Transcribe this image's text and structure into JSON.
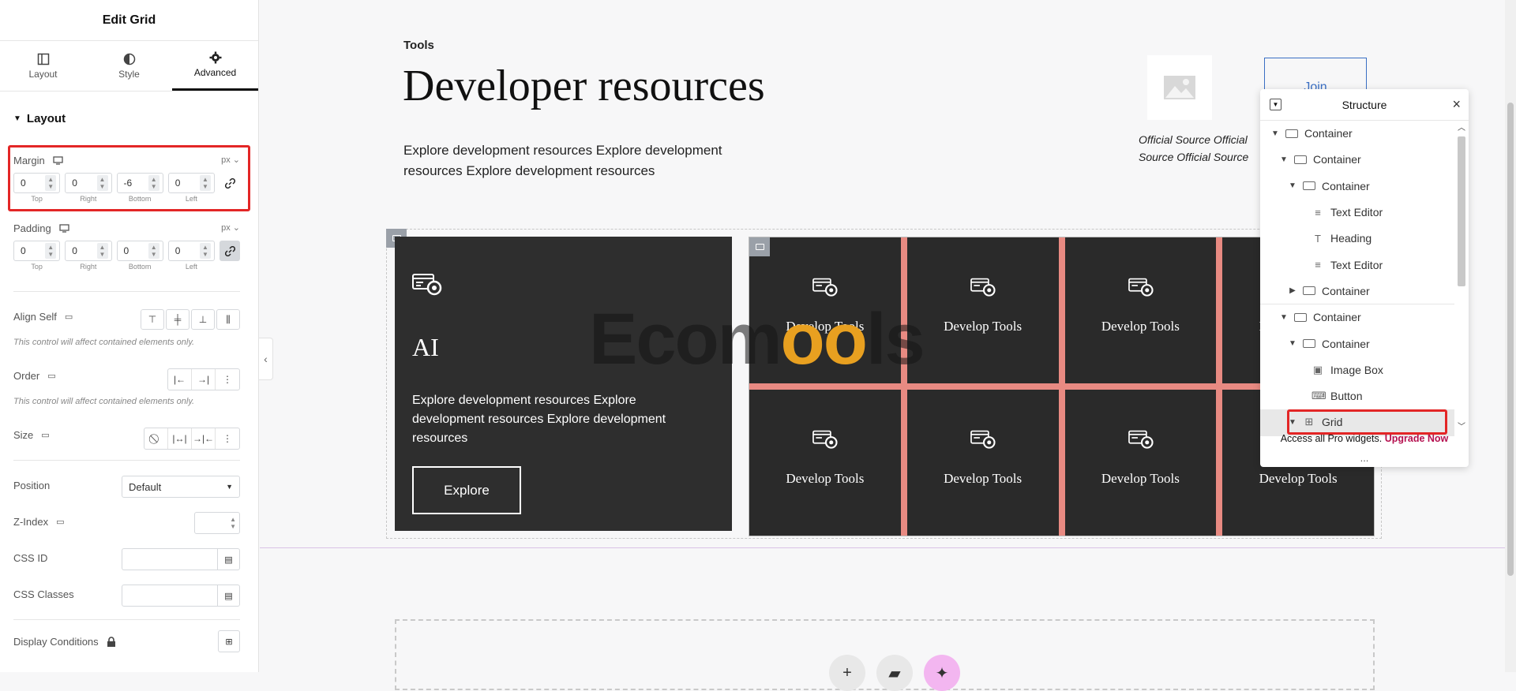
{
  "panel": {
    "title": "Edit Grid",
    "tabs": [
      {
        "label": "Layout"
      },
      {
        "label": "Style"
      },
      {
        "label": "Advanced"
      }
    ],
    "section": "Layout",
    "margin": {
      "label": "Margin",
      "unit": "px",
      "top": "0",
      "right": "0",
      "bottom": "-6",
      "left": "0"
    },
    "padding": {
      "label": "Padding",
      "unit": "px",
      "top": "0",
      "right": "0",
      "bottom": "0",
      "left": "0"
    },
    "sides": [
      "Top",
      "Right",
      "Bottom",
      "Left"
    ],
    "align_self": {
      "label": "Align Self",
      "note": "This control will affect contained elements only."
    },
    "order": {
      "label": "Order",
      "note": "This control will affect contained elements only."
    },
    "size": {
      "label": "Size"
    },
    "position": {
      "label": "Position",
      "value": "Default"
    },
    "zindex": {
      "label": "Z-Index"
    },
    "css_id": {
      "label": "CSS ID"
    },
    "css_classes": {
      "label": "CSS Classes"
    },
    "display_conditions": {
      "label": "Display Conditions"
    }
  },
  "canvas": {
    "eyebrow": "Tools",
    "heading": "Developer resources",
    "description": "Explore development resources Explore development resources Explore development resources",
    "join_label": "Join",
    "official": "Official Source Official Source Official Source",
    "ai_card": {
      "title": "AI",
      "text": "Explore development resources Explore development resources Explore development resources",
      "button": "Explore"
    },
    "grid_items": [
      "Develop Tools",
      "Develop Tools",
      "Develop Tools",
      "Develop Tools",
      "Develop Tools",
      "Develop Tools",
      "Develop Tools",
      "Develop Tools"
    ],
    "watermark": {
      "a": "Ecom",
      "b": "oo",
      "c": "ls"
    }
  },
  "structure": {
    "title": "Structure",
    "nodes": [
      {
        "label": "Container",
        "icon": "container",
        "level": 0,
        "caret": "down"
      },
      {
        "label": "Container",
        "icon": "container",
        "level": 1,
        "caret": "down"
      },
      {
        "label": "Container",
        "icon": "container",
        "level": 2,
        "caret": "down"
      },
      {
        "label": "Text Editor",
        "icon": "text",
        "level": 3,
        "caret": ""
      },
      {
        "label": "Heading",
        "icon": "heading",
        "level": 3,
        "caret": ""
      },
      {
        "label": "Text Editor",
        "icon": "text",
        "level": 3,
        "caret": ""
      },
      {
        "label": "Container",
        "icon": "container",
        "level": 2,
        "caret": "right"
      },
      {
        "label": "Container",
        "icon": "container",
        "level": 1,
        "caret": "down"
      },
      {
        "label": "Container",
        "icon": "container",
        "level": 2,
        "caret": "down"
      },
      {
        "label": "Image Box",
        "icon": "image",
        "level": 3,
        "caret": ""
      },
      {
        "label": "Button",
        "icon": "button",
        "level": 3,
        "caret": ""
      },
      {
        "label": "Grid",
        "icon": "grid",
        "level": 2,
        "caret": "down"
      }
    ],
    "footer_text": "Access all Pro widgets.",
    "footer_link": "Upgrade Now",
    "more": "..."
  },
  "colors": {
    "accent_red": "#e32626",
    "grid_gap": "#e88a82",
    "upgrade": "#b5104f"
  }
}
